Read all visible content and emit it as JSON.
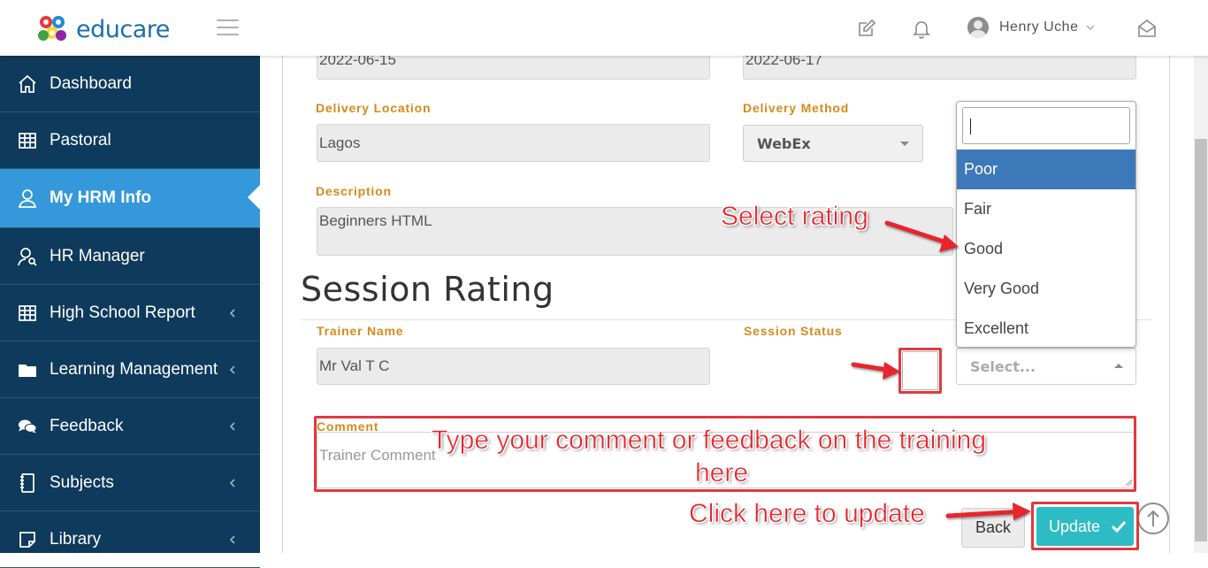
{
  "app": {
    "logo_text": "educare"
  },
  "header": {
    "user_name": "Henry Uche",
    "icons": [
      "edit-icon",
      "bell-icon",
      "mail-open-icon"
    ]
  },
  "sidebar": {
    "items": [
      {
        "label": "Dashboard",
        "icon": "home-icon"
      },
      {
        "label": "Pastoral",
        "icon": "table-icon"
      },
      {
        "label": "My HRM Info",
        "icon": "user-icon",
        "active": true
      },
      {
        "label": "HR Manager",
        "icon": "user-search-icon"
      },
      {
        "label": "High School Report",
        "icon": "table-icon",
        "has_children": true
      },
      {
        "label": "Learning Management",
        "icon": "folder-icon",
        "has_children": true
      },
      {
        "label": "Feedback",
        "icon": "comments-icon",
        "has_children": true
      },
      {
        "label": "Subjects",
        "icon": "book-icon",
        "has_children": true
      },
      {
        "label": "Library",
        "icon": "note-icon",
        "has_children": true
      }
    ]
  },
  "form": {
    "start_date": "2022-06-15",
    "end_date": "2022-06-17",
    "delivery_location_label": "Delivery Location",
    "delivery_location": "Lagos",
    "delivery_method_label": "Delivery Method",
    "delivery_method": "WebEx",
    "description_label": "Description",
    "description": "Beginners HTML"
  },
  "session_rating": {
    "title": "Session Rating",
    "trainer_name_label": "Trainer Name",
    "trainer_name": "Mr Val T C",
    "session_status_label": "Session Status",
    "rating_select_placeholder": "Select...",
    "comment_label": "Comment",
    "comment_placeholder": "Trainer Comment"
  },
  "rating_dropdown": {
    "options": [
      "Poor",
      "Fair",
      "Good",
      "Very Good",
      "Excellent"
    ],
    "highlighted": "Poor"
  },
  "buttons": {
    "back": "Back",
    "update": "Update"
  },
  "annotations": {
    "select_rating": "Select rating",
    "comment_line1": "Type your comment or feedback on the training",
    "comment_line2": "here",
    "update": "Click here to update"
  },
  "colors": {
    "sidebar_bg": "#0e3a5c",
    "sidebar_active": "#3498db",
    "label_orange": "#d68a1c",
    "update_button": "#2dbcc4",
    "dropdown_highlight": "#3d79b8",
    "annotation_red": "#e8252b"
  }
}
